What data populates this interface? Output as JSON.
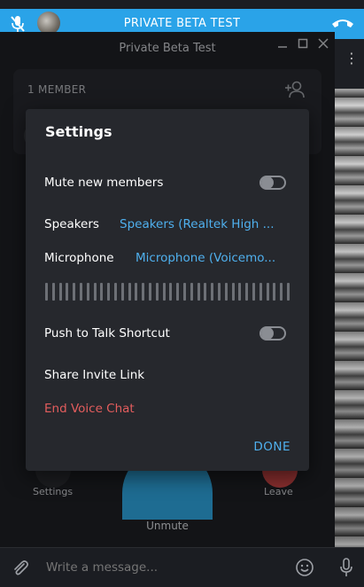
{
  "call_bar": {
    "title": "PRIVATE BETA TEST"
  },
  "window": {
    "title": "Private Beta Test"
  },
  "members": {
    "count_label": "1 MEMBER"
  },
  "controls": {
    "settings_label": "Settings",
    "leave_label": "Leave",
    "unmute_label": "Unmute"
  },
  "settings_modal": {
    "title": "Settings",
    "mute_new_members": {
      "label": "Mute new members",
      "enabled": false
    },
    "speakers": {
      "label": "Speakers",
      "value": "Speakers (Realtek High ..."
    },
    "microphone": {
      "label": "Microphone",
      "value": "Microphone (Voicemo..."
    },
    "push_to_talk": {
      "label": "Push to Talk Shortcut",
      "enabled": false
    },
    "share_invite": {
      "label": "Share Invite Link"
    },
    "end_voice_chat": {
      "label": "End Voice Chat"
    },
    "done": "DONE"
  },
  "message_bar": {
    "placeholder": "Write a message..."
  },
  "colors": {
    "accent": "#4fb0ee",
    "call_bar": "#2aa3e8",
    "danger": "#e35d5d",
    "modal_bg": "#26282d"
  }
}
